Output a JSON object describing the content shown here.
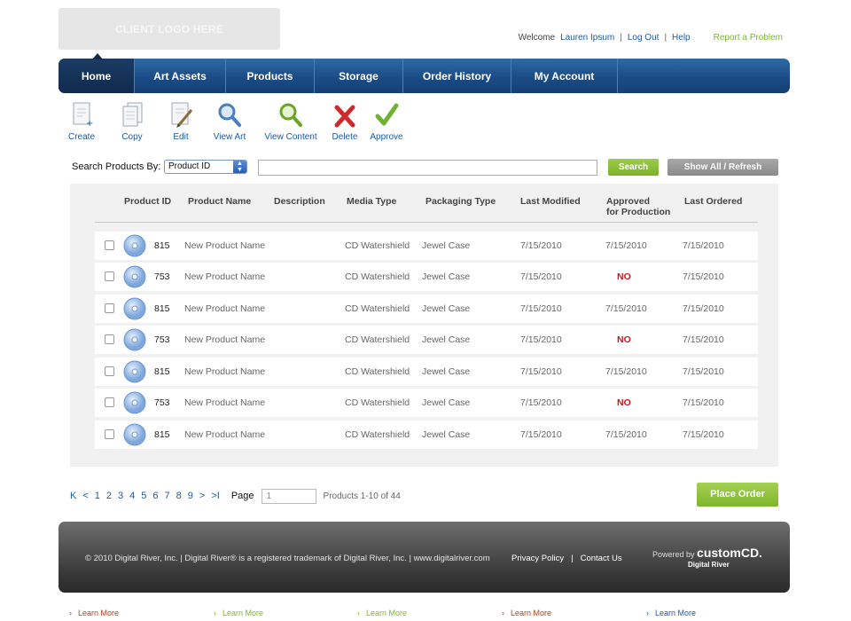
{
  "header": {
    "logo_text": "CLIENT LOGO HERE",
    "welcome": "Welcome",
    "user_name": "Lauren Ipsum",
    "logout": "Log Out",
    "help": "Help",
    "report": "Report a Problem",
    "sep": "|"
  },
  "nav": {
    "tabs": [
      {
        "label": "Home",
        "active": true
      },
      {
        "label": "Art Assets"
      },
      {
        "label": "Products"
      },
      {
        "label": "Storage"
      },
      {
        "label": "Order History"
      },
      {
        "label": "My Account"
      }
    ]
  },
  "toolbar": {
    "items": [
      {
        "label": "Create",
        "icon": "create-icon"
      },
      {
        "label": "Copy",
        "icon": "copy-icon"
      },
      {
        "label": "Edit",
        "icon": "edit-icon"
      },
      {
        "label": "View Art",
        "icon": "magnifier-icon"
      },
      {
        "label": "View Content",
        "icon": "magnifier-green-icon"
      },
      {
        "label": "Delete",
        "icon": "red-x-icon"
      },
      {
        "label": "Approve",
        "icon": "green-check-icon"
      }
    ]
  },
  "search": {
    "label": "Search Products By:",
    "selected": "Product ID",
    "query": "",
    "search_button": "Search",
    "show_all_button": "Show All / Refresh"
  },
  "table": {
    "headers": {
      "product_id": "Product ID",
      "product_name": "Product Name",
      "description": "Description",
      "media_type": "Media Type",
      "packaging_type": "Packaging Type",
      "last_modified": "Last Modified",
      "approved_1": "Approved",
      "approved_2": "for Production",
      "last_ordered": "Last Ordered"
    },
    "rows": [
      {
        "id": "815",
        "name": "New Product Name",
        "media": "CD Watershield",
        "packaging": "Jewel Case",
        "modified": "7/15/2010",
        "approved": "7/15/2010",
        "ordered": "7/15/2010"
      },
      {
        "id": "753",
        "name": "New Product Name",
        "media": "CD Watershield",
        "packaging": "Jewel Case",
        "modified": "7/15/2010",
        "approved": "NO",
        "ordered": "7/15/2010"
      },
      {
        "id": "815",
        "name": "New Product Name",
        "media": "CD Watershield",
        "packaging": "Jewel Case",
        "modified": "7/15/2010",
        "approved": "7/15/2010",
        "ordered": "7/15/2010"
      },
      {
        "id": "753",
        "name": "New Product Name",
        "media": "CD Watershield",
        "packaging": "Jewel Case",
        "modified": "7/15/2010",
        "approved": "NO",
        "ordered": "7/15/2010"
      },
      {
        "id": "815",
        "name": "New Product Name",
        "media": "CD Watershield",
        "packaging": "Jewel Case",
        "modified": "7/15/2010",
        "approved": "7/15/2010",
        "ordered": "7/15/2010"
      },
      {
        "id": "753",
        "name": "New Product Name",
        "media": "CD Watershield",
        "packaging": "Jewel Case",
        "modified": "7/15/2010",
        "approved": "NO",
        "ordered": "7/15/2010"
      },
      {
        "id": "815",
        "name": "New Product Name",
        "media": "CD Watershield",
        "packaging": "Jewel Case",
        "modified": "7/15/2010",
        "approved": "7/15/2010",
        "ordered": "7/15/2010"
      }
    ]
  },
  "pager": {
    "first": "K",
    "prev": "<",
    "pages": [
      "1",
      "2",
      "3",
      "4",
      "5",
      "6",
      "7",
      "8",
      "9"
    ],
    "next": ">",
    "last": ">I",
    "page_label": "Page",
    "page_value": "1",
    "count": "Products 1-10 of 44"
  },
  "place_order": "Place Order",
  "footer": {
    "copyright": "© 2010 Digital River, Inc. | Digital River® is a registered trademark of Digital River, Inc. | www.digitalriver.com",
    "privacy": "Privacy Policy",
    "contact": "Contact Us",
    "sep": "|",
    "powered": "Powered by",
    "brand": "customCD.",
    "parent": "Digital River"
  },
  "learn_more": [
    "Learn More",
    "Learn More",
    "Learn More",
    "Learn More",
    "Learn More"
  ],
  "colors": {
    "nav": "#1b4c86",
    "link": "#1a5aa8",
    "green": "#7fb52d",
    "no": "#c8161d"
  }
}
